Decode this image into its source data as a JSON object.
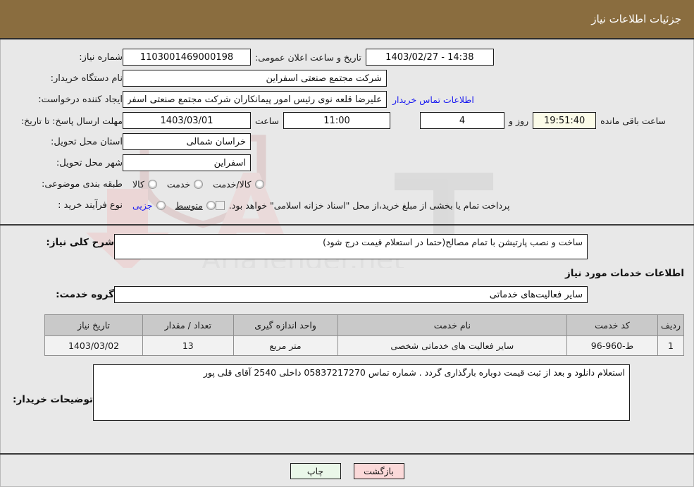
{
  "header": {
    "title": "جزئیات اطلاعات نیاز",
    "bg": "#8a6d3f",
    "text_color": "#ffffff"
  },
  "watermark": {
    "text": "AriaTender.net",
    "color": "#e7c9c9"
  },
  "top_form": {
    "need_number_label": "شماره نیاز:",
    "need_number_value": "1103001469000198",
    "public_announce_label": "تاریخ و ساعت اعلان عمومی:",
    "public_announce_value": "14:38 - 1403/02/27",
    "buyer_org_label": "نام دستگاه خریدار:",
    "buyer_org_value": "شرکت مجتمع صنعتی اسفراین",
    "creator_label": "ایجاد کننده درخواست:",
    "creator_value": "علیرضا قلعه نوی رئیس امور پیمانکاران شرکت مجتمع صنعتی اسفراین",
    "contact_link": "اطلاعات تماس خریدار",
    "deadline_label": "مهلت ارسال پاسخ: تا تاریخ:",
    "deadline_date": "1403/03/01",
    "hour_label": "ساعت",
    "deadline_time": "11:00",
    "days_value": "4",
    "days_label": "روز و",
    "countdown_value": "19:51:40",
    "countdown_label": "ساعت باقی مانده",
    "province_label": "استان محل تحویل:",
    "province_value": "خراسان شمالی",
    "city_label": "شهر محل تحویل:",
    "city_value": "اسفراین",
    "category_label": "طبقه بندی موضوعی:",
    "category_options": [
      {
        "label": "کالا",
        "checked": false
      },
      {
        "label": "خدمت",
        "checked": false
      },
      {
        "label": "کالا/خدمت",
        "checked": false
      }
    ],
    "process_label": "نوع فرآیند خرید :",
    "process_options": [
      {
        "label": "جزیی",
        "checked": false,
        "style": "blue"
      },
      {
        "label": "متوسط",
        "checked": false,
        "style": "under"
      }
    ],
    "treasury_checkbox_checked": false,
    "treasury_note": "پرداخت تمام یا بخشی از مبلغ خرید،از محل \"اسناد خزانه اسلامی\" خواهد بود."
  },
  "middle": {
    "general_desc_label": "شرح کلی نیاز:",
    "general_desc_value": "ساخت و نصب پارتیشن با تمام مصالح(حتما در استعلام قیمت درج شود)",
    "services_section_title": "اطلاعات خدمات مورد نیاز",
    "service_group_label": "گروه خدمت:",
    "service_group_value": "سایر فعالیت‌های خدماتی"
  },
  "items_table": {
    "columns": [
      "ردیف",
      "کد خدمت",
      "نام خدمت",
      "واحد اندازه گیری",
      "تعداد / مقدار",
      "تاریخ نیاز"
    ],
    "rows": [
      {
        "index": "1",
        "code": "ط-960-96",
        "name": "سایر فعالیت های خدماتی شخصی",
        "unit": "متر مربع",
        "quantity": "13",
        "need_date": "1403/03/02"
      }
    ]
  },
  "buyer_notes": {
    "label": "توضیحات خریدار:",
    "value": "استعلام دانلود و بعد از ثبت قیمت دوباره بارگذاری گردد . شماره تماس 05837217270 داخلی 2540 آقای قلی پور"
  },
  "footer": {
    "print_label": "چاپ",
    "back_label": "بازگشت",
    "print_bg": "#eaf7e9",
    "back_bg": "#fbd9d9"
  }
}
